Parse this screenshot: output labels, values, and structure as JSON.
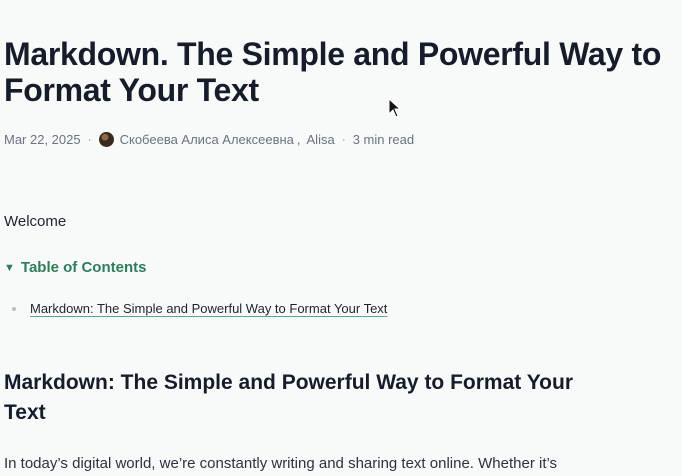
{
  "article": {
    "title": "Markdown. The Simple and Powerful Way to Format Your Text",
    "meta": {
      "date": "Mar 22, 2025",
      "author_primary": "Скобеева Алиса Алексеевна",
      "author_separator": ",",
      "author_secondary": "Alisa",
      "read_time": "3 min read",
      "separator": "·"
    },
    "welcome": "Welcome",
    "toc": {
      "label": "Table of Contents",
      "items": [
        {
          "label": "Markdown: The Simple and Powerful Way to Format Your Text"
        }
      ]
    },
    "section_heading": "Markdown: The Simple and Powerful Way to Format Your Text",
    "intro_paragraph": "In today’s digital world, we’re constantly writing and sharing text online. Whether it’s"
  },
  "icons": {
    "toc_toggle": "triangle-down-icon",
    "avatar": "author-avatar",
    "cursor": "mouse-pointer-icon"
  },
  "colors": {
    "background": "#f8fafa",
    "text": "#1d2330",
    "meta": "#6b7280",
    "accent": "#2e7d5b",
    "link_underline": "#5aa887"
  }
}
